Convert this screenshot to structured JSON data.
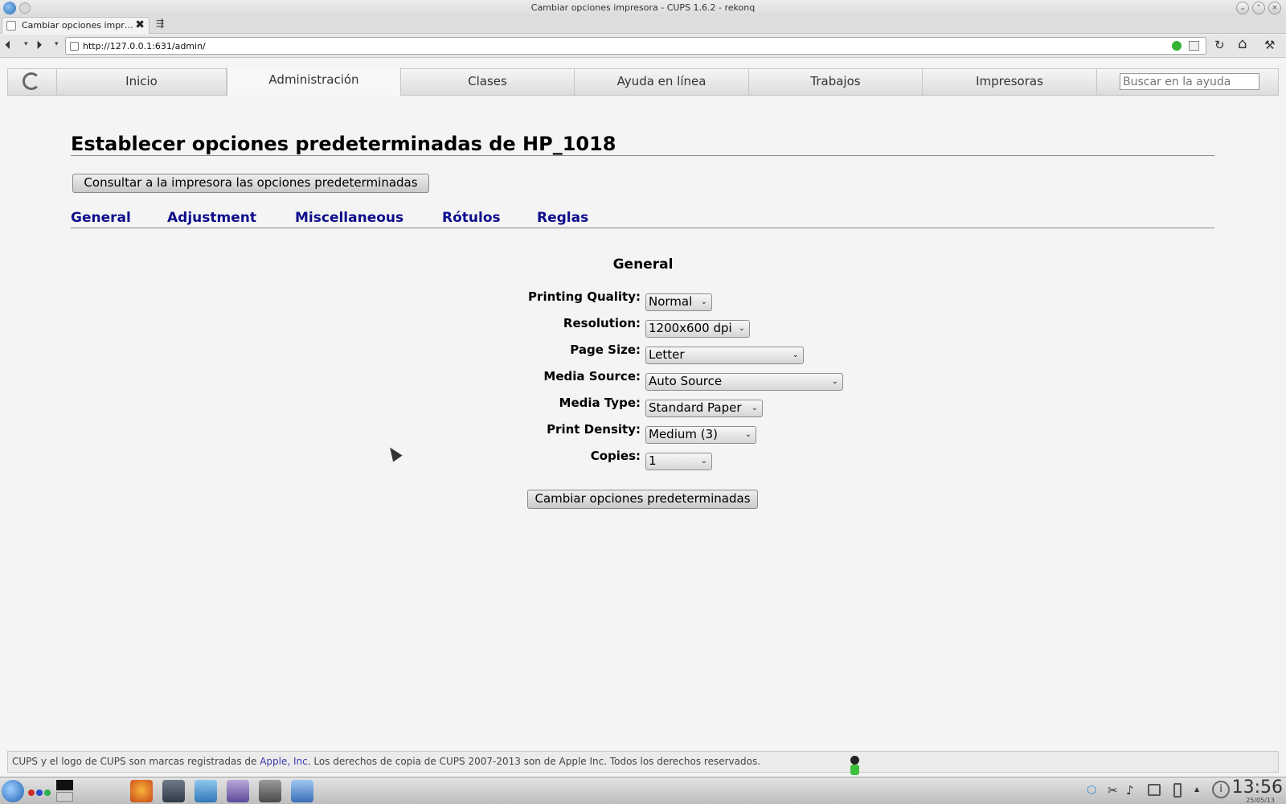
{
  "window": {
    "title": "Cambiar opciones impresora - CUPS 1.6.2 - rekonq",
    "min_icon": "⌄",
    "max_icon": "⌃",
    "close_icon": "×"
  },
  "tabs": [
    {
      "label": "Cambiar opciones impr…",
      "close": "✖"
    }
  ],
  "new_tab_glyph": "⇶",
  "toolbar": {
    "back": "⏴",
    "forward": "⏵",
    "dropdown": "▾",
    "url": "http://127.0.0.1:631/admin/",
    "reload": "↻",
    "home": "⌂",
    "tools": "⚒"
  },
  "cups_nav": {
    "items": [
      "Inicio",
      "Administración",
      "Clases",
      "Ayuda en línea",
      "Trabajos",
      "Impresoras"
    ],
    "active": "Administración",
    "search_placeholder": "Buscar en la ayuda"
  },
  "page": {
    "title": "Establecer opciones predeterminadas de HP_1018",
    "query_button": "Consultar a la impresora las opciones predeterminadas",
    "section_tabs": [
      "General",
      "Adjustment",
      "Miscellaneous",
      "Rótulos",
      "Reglas"
    ],
    "form_heading": "General",
    "fields": [
      {
        "label": "Printing Quality:",
        "value": "Normal"
      },
      {
        "label": "Resolution:",
        "value": "1200x600 dpi"
      },
      {
        "label": "Page Size:",
        "value": "Letter"
      },
      {
        "label": "Media Source:",
        "value": "Auto Source"
      },
      {
        "label": "Media Type:",
        "value": "Standard Paper"
      },
      {
        "label": "Print Density:",
        "value": "Medium (3)"
      },
      {
        "label": "Copies:",
        "value": "1"
      }
    ],
    "submit_button": "Cambiar opciones predeterminadas",
    "select_arrow": "⌄"
  },
  "footer": {
    "prefix": "CUPS y el logo de CUPS son marcas registradas de ",
    "link": "Apple, Inc",
    "suffix": ". Los derechos de copia de CUPS 2007-2013 son de Apple Inc. Todos los derechos reservados."
  },
  "taskbar": {
    "time": "13:56",
    "date": "25/05/13",
    "tray_icons": [
      "network-icon",
      "scissors-icon",
      "volume-icon",
      "printer-icon",
      "battery-icon",
      "info-icon"
    ],
    "colors": {
      "firefox": "#e8731f",
      "dots": [
        "#d02a2a",
        "#2a4ad0",
        "#2ab04a"
      ]
    }
  }
}
